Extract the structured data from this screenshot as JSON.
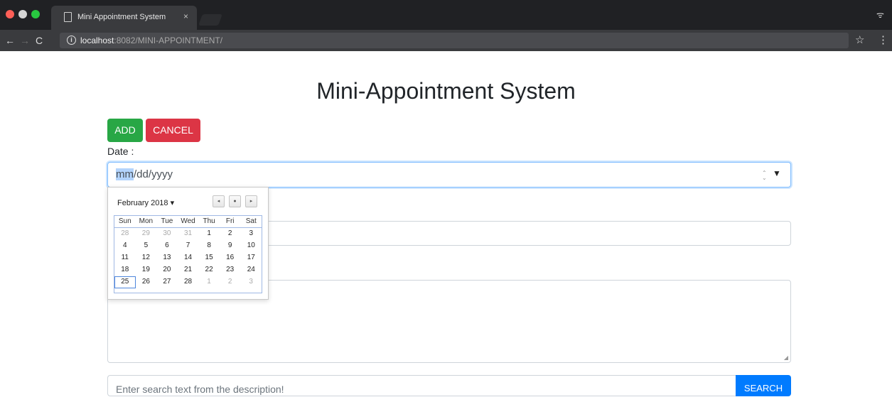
{
  "browser": {
    "tab_title": "Mini Appointment System",
    "tab_close": "×",
    "url_host": "localhost",
    "url_path": ":8082/MINI-APPOINTMENT/",
    "info_glyph": "i",
    "star": "☆",
    "menu": "⋮",
    "back": "←",
    "forward": "→",
    "reload": "C",
    "incognito": "ᯤ"
  },
  "page": {
    "title": "Mini-Appointment System",
    "add_label": "ADD",
    "cancel_label": "CANCEL",
    "date_label": "Date :",
    "date_placeholder_mm": "mm",
    "date_placeholder_rest": "/dd/yyyy",
    "search_placeholder": "Enter search text from the description!",
    "search_label": "SEARCH"
  },
  "calendar": {
    "month_label": "February 2018 ▾",
    "prev": "◂",
    "today": "●",
    "next": "▸",
    "weekdays": [
      "Sun",
      "Mon",
      "Tue",
      "Wed",
      "Thu",
      "Fri",
      "Sat"
    ],
    "weeks": [
      [
        "28",
        "29",
        "30",
        "31",
        "1",
        "2",
        "3"
      ],
      [
        "4",
        "5",
        "6",
        "7",
        "8",
        "9",
        "10"
      ],
      [
        "11",
        "12",
        "13",
        "14",
        "15",
        "16",
        "17"
      ],
      [
        "18",
        "19",
        "20",
        "21",
        "22",
        "23",
        "24"
      ],
      [
        "25",
        "26",
        "27",
        "28",
        "1",
        "2",
        "3"
      ]
    ],
    "muted": [
      [
        0,
        0
      ],
      [
        0,
        1
      ],
      [
        0,
        2
      ],
      [
        0,
        3
      ],
      [
        4,
        4
      ],
      [
        4,
        5
      ],
      [
        4,
        6
      ]
    ],
    "selected_cell": [
      4,
      0
    ]
  },
  "colors": {
    "add": "#28a745",
    "cancel": "#dc3545",
    "search": "#007bff"
  }
}
